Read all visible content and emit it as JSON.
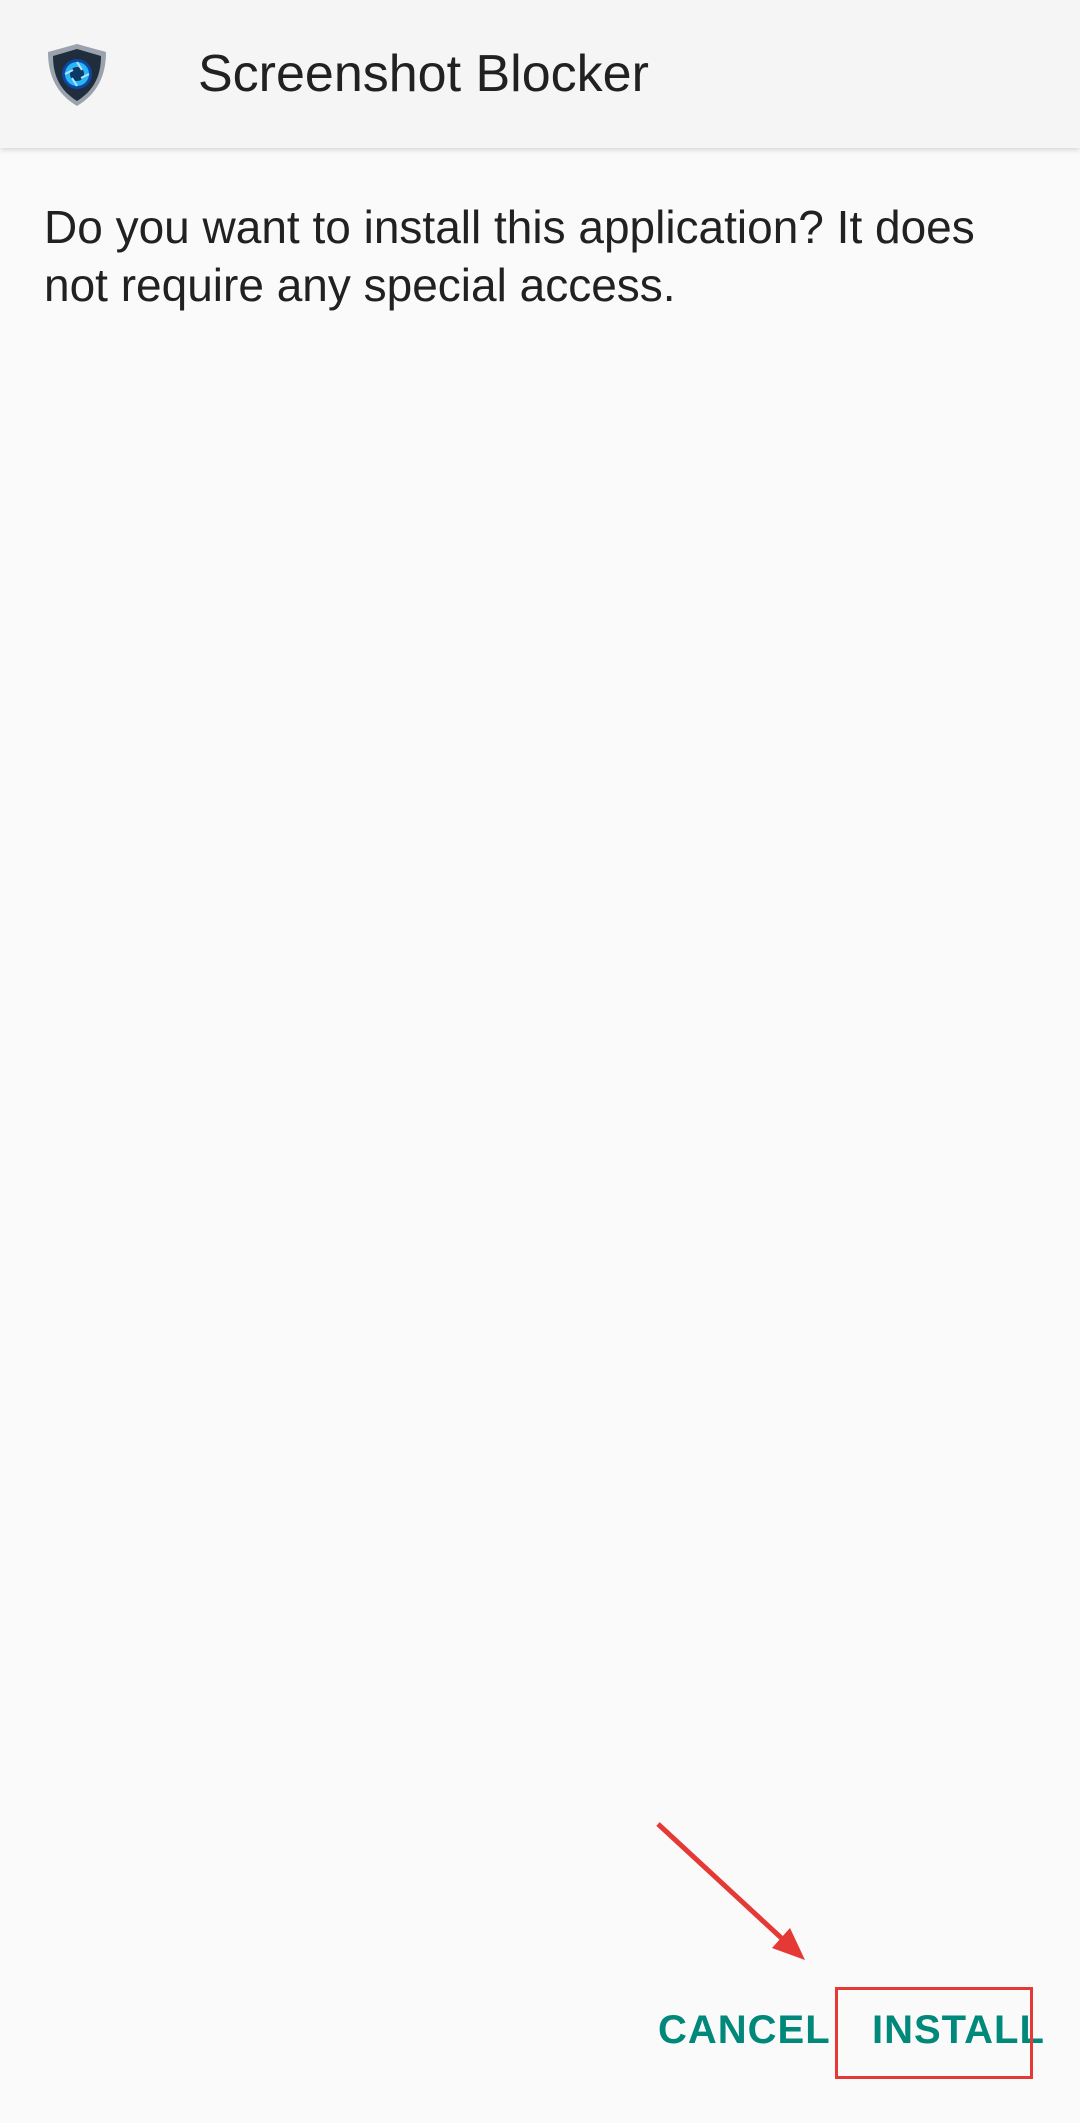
{
  "app_bar": {
    "title": "Screenshot Blocker",
    "icon": "shield-shutter-icon"
  },
  "dialog": {
    "message": "Do you want to install this application? It does not require any special access."
  },
  "actions": {
    "cancel_label": "CANCEL",
    "install_label": "INSTALL"
  },
  "colors": {
    "accent": "#00897b",
    "annotation": "#e53935",
    "background": "#fafafa",
    "app_bar": "#f5f5f5"
  }
}
